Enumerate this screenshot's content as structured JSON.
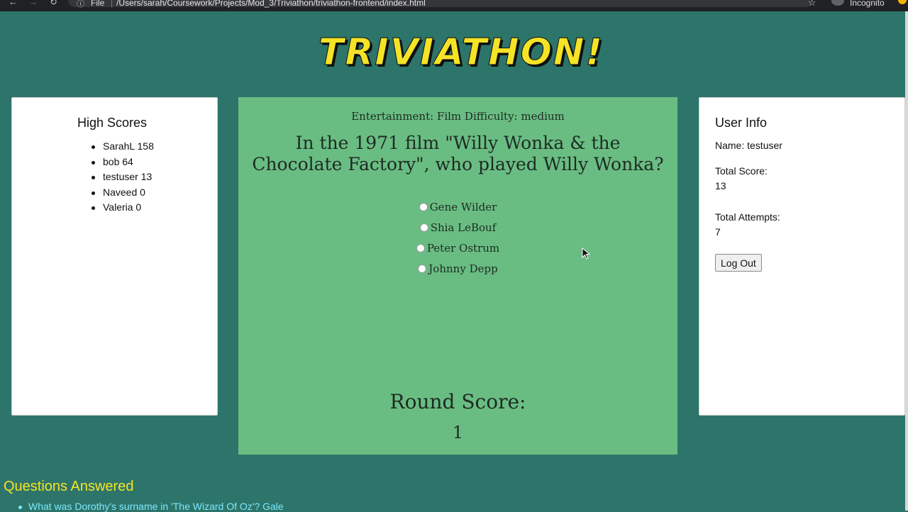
{
  "browser": {
    "file_label": "File",
    "url": "/Users/sarah/Coursework/Projects/Mod_3/Triviathon/triviathon-frontend/index.html",
    "incognito_label": "Incognito"
  },
  "title": "TRIVIATHON!",
  "high_scores": {
    "title": "High Scores",
    "entries": [
      "SarahL 158",
      "bob 64",
      "testuser 13",
      "Naveed 0",
      "Valeria 0"
    ]
  },
  "question": {
    "category_line": "Entertainment: Film Difficulty: medium",
    "text": "In the 1971 film \"Willy Wonka & the Chocolate Factory\", who played Willy Wonka?",
    "answers": [
      "Gene Wilder",
      "Shia LeBouf",
      "Peter Ostrum",
      "Johnny Depp"
    ],
    "round_score_label": "Round Score:",
    "round_score_value": "1"
  },
  "user_info": {
    "title": "User Info",
    "name_line": "Name: testuser",
    "total_score_label": "Total Score:",
    "total_score_value": "13",
    "total_attempts_label": "Total Attempts:",
    "total_attempts_value": "7",
    "logout_label": "Log Out"
  },
  "questions_answered": {
    "title": "Questions Answered",
    "items": [
      "What was Dorothy's surname in 'The Wizard Of Oz'? Gale"
    ]
  }
}
